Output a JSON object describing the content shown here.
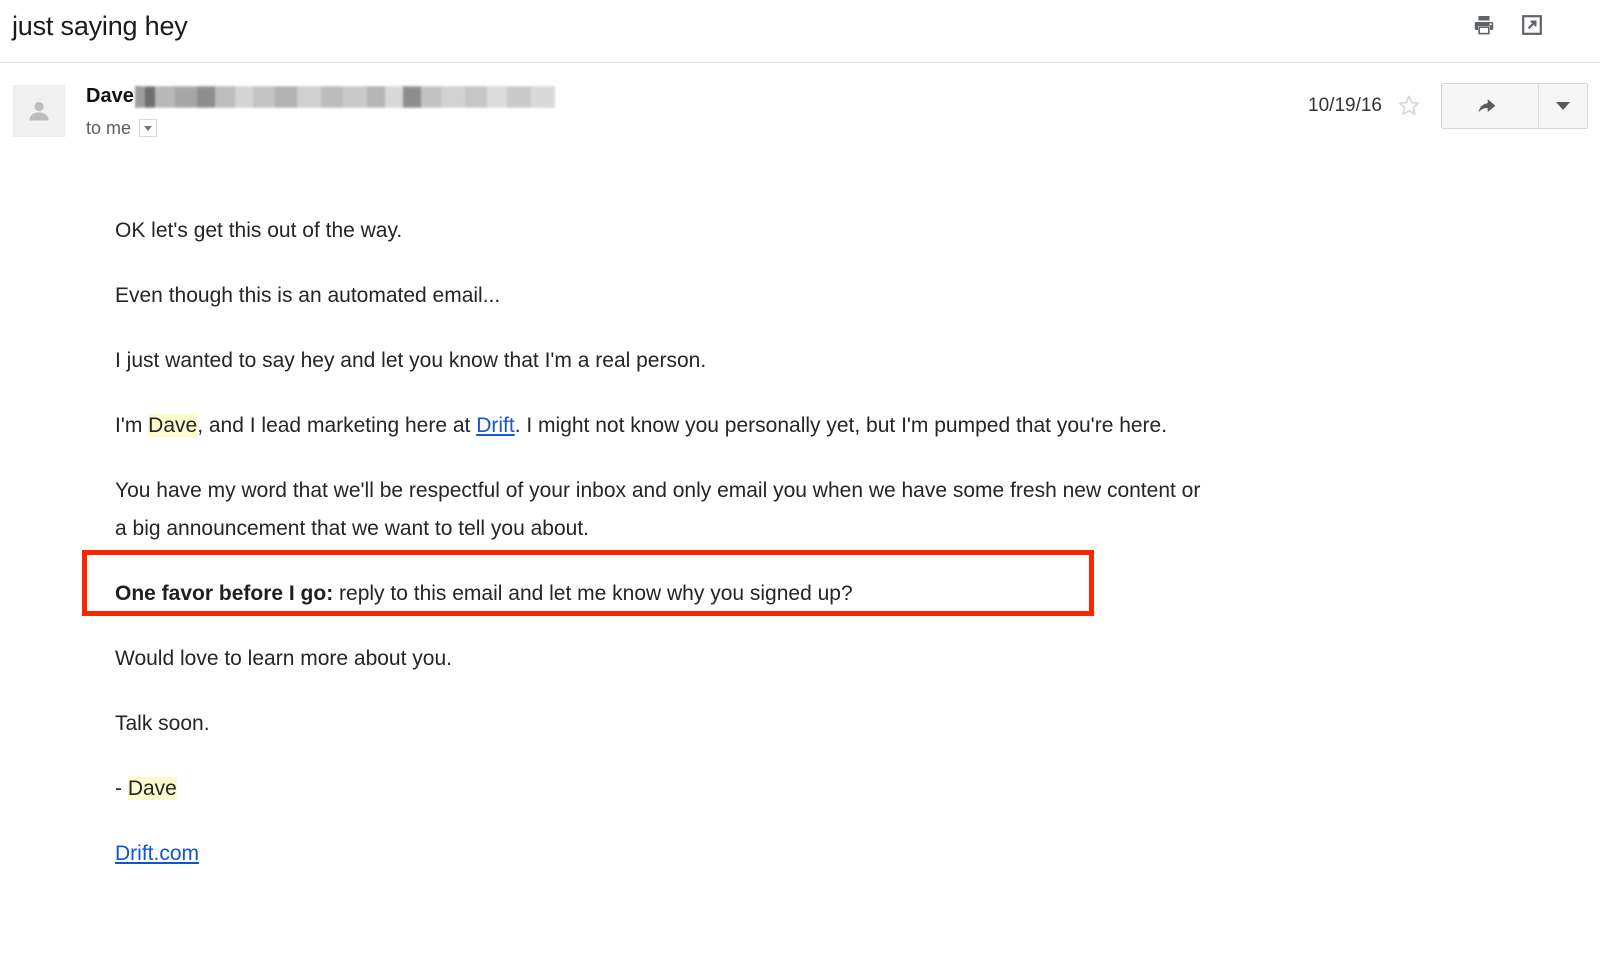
{
  "subject": {
    "title": "just saying hey",
    "print_icon": "print-icon",
    "popout_icon": "open-in-new-window-icon"
  },
  "message_header": {
    "avatar_icon": "person-avatar-icon",
    "sender_name": "Dave",
    "sender_email_redacted": "",
    "recipient": "to me",
    "details_caret": "chevron-down-icon",
    "date": "10/19/16",
    "star_icon": "star-outline-icon",
    "reply_icon": "reply-arrow-icon",
    "more_caret": "chevron-down-icon"
  },
  "body": {
    "p1": "OK let's get this out of the way.",
    "p2": "Even though this is an automated email...",
    "p3": "I just wanted to say hey and let you know that I'm a real person.",
    "p4_a": "I'm ",
    "p4_highlight": "Dave",
    "p4_b": ", and I lead marketing here at ",
    "p4_link": "Drift",
    "p4_c": ". I might not know you personally yet, but I'm pumped that you're here.",
    "p5": "You have my word that we'll be respectful of your inbox and only email you when we have some fresh new content or a big announcement that we want to tell you about.",
    "p6_bold": "One favor before I go:",
    "p6_rest": " reply to this email and let me know why you signed up?",
    "p7": "Would love to learn more about you.",
    "p8": "Talk soon.",
    "p9_dash": "- ",
    "p9_highlight": "Dave",
    "p10_link": "Drift.com"
  },
  "colors": {
    "annotation_red": "#fa2600",
    "highlight_yellow": "#fbfbcd",
    "link_blue": "#1155cc"
  }
}
